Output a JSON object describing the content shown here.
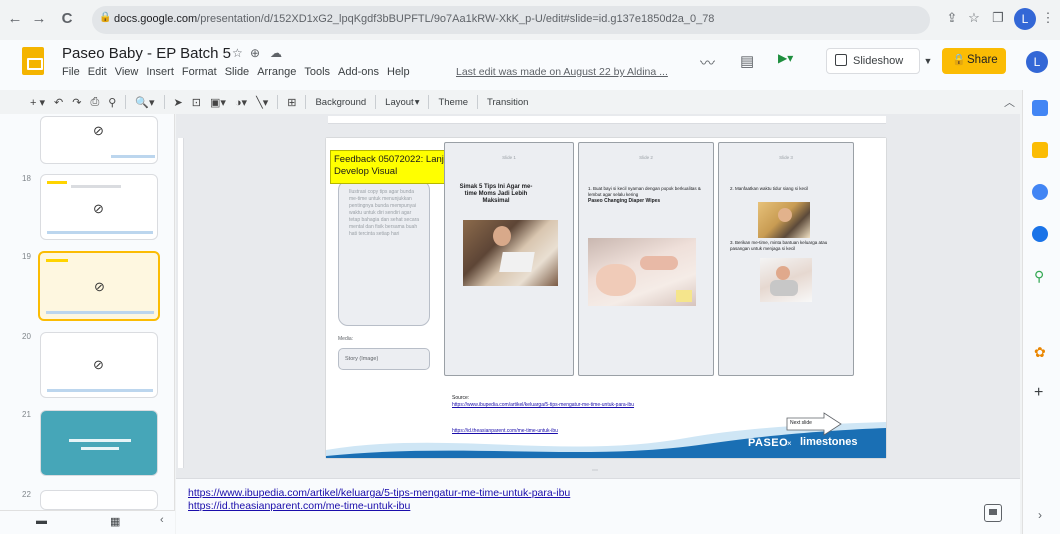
{
  "browser": {
    "url_host": "docs.google.com",
    "url_path": "/presentation/d/152XD1xG2_lpqKgdf3bBUPFTL/9o7Aa1kRW-XkK_p-U/edit#slide=id.g137e1850d2a_0_78",
    "nav": {
      "back": "←",
      "forward": "→",
      "reload": "C"
    },
    "profile_initial": "L"
  },
  "doc": {
    "title": "Paseo Baby - EP Batch 5",
    "menu": [
      "File",
      "Edit",
      "View",
      "Insert",
      "Format",
      "Slide",
      "Arrange",
      "Tools",
      "Add-ons",
      "Help"
    ],
    "last_edit": "Last edit was made on August 22 by Aldina ...",
    "slideshow_label": "Slideshow",
    "share_label": "Share",
    "account_initial": "L"
  },
  "toolbar": {
    "background_label": "Background",
    "layout_label": "Layout",
    "theme_label": "Theme",
    "transition_label": "Transition"
  },
  "filmstrip": {
    "slides": [
      {
        "num": "",
        "selected": false
      },
      {
        "num": "18",
        "selected": false
      },
      {
        "num": "19",
        "selected": true
      },
      {
        "num": "20",
        "selected": false
      },
      {
        "num": "21",
        "selected": false
      },
      {
        "num": "22",
        "selected": false
      }
    ]
  },
  "slide": {
    "feedback_note": "Feedback 05072022: Lanjut Develop Visual",
    "left_copy": "Ilustrasi copy tips agar bunda me-time untuk menunjukkan pentingnya bunda mempunyai waktu untuk diri sendiri agar tetap bahagia dan sehat secara mental dan fisik bersama buah hati tercinta setiap hari",
    "media_label": "Media:",
    "media_value": "Story (Image)",
    "panel_titles": [
      "Slide 1",
      "Slide 2",
      "Slide 3"
    ],
    "panel1_title": "Simak 5 Tips Ini Agar me-time Moms Jadi Lebih Maksimal",
    "panel2_text": "1. Buat bayi si kecil nyaman dengan popok berkualitas & lembut agar selalu kering",
    "panel2_bold": "Paseo Changing Diaper Wipes",
    "panel3_text1": "2. Manfaatkan waktu tidur siang si kecil",
    "panel3_text2": "3. Berikan me-time, minta bantuan keluarga atau pasangan untuk menjaga si kecil",
    "source_label": "Source:",
    "source_links": [
      "https://www.ibupedia.com/artikel/keluarga/5-tips-mengatur-me-time-untuk-para-ibu",
      "https://id.theasianparent.com/me-time-untuk-ibu"
    ],
    "brand_left": "PASEO",
    "brand_x": "×",
    "brand_right": "limestones",
    "next_slide_label": "Next slide"
  },
  "notes": {
    "links": [
      "https://www.ibupedia.com/artikel/keluarga/5-tips-mengatur-me-time-untuk-para-ibu",
      "https://id.theasianparent.com/me-time-untuk-ibu"
    ]
  },
  "colors": {
    "share_yellow": "#fbbc04",
    "feedback_yellow": "#ffff00",
    "link_blue": "#1a0dab",
    "slide_accent": "#1a6fb4"
  }
}
